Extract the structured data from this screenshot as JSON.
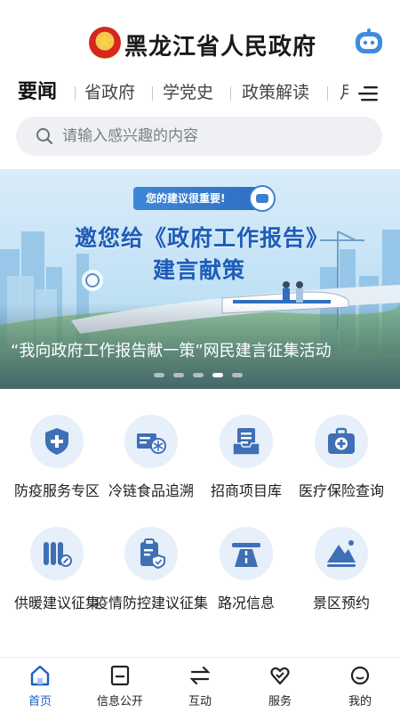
{
  "header": {
    "title": "黑龙江省人民政府",
    "emblem_icon": "national-emblem-icon",
    "assistant_icon": "robot-assistant-icon"
  },
  "nav": {
    "tabs": [
      {
        "label": "要闻",
        "active": true
      },
      {
        "label": "省政府",
        "active": false
      },
      {
        "label": "学党史",
        "active": false
      },
      {
        "label": "政策解读",
        "active": false
      },
      {
        "label": "月",
        "active": false
      }
    ],
    "menu_icon": "menu-icon"
  },
  "search": {
    "placeholder": "请输入感兴趣的内容",
    "icon": "search-icon"
  },
  "banner": {
    "badge": "您的建议很重要!",
    "headline_line1": "邀您给《政府工作报告》",
    "headline_line2": "建言献策",
    "caption": "“我向政府工作报告献一策”网民建言征集活动",
    "slide_count": 5,
    "active_slide": 4
  },
  "services": [
    {
      "label": "防疫服务专区",
      "icon": "shield-plus-icon"
    },
    {
      "label": "冷链食品追溯",
      "icon": "cold-chain-truck-icon"
    },
    {
      "label": "招商项目库",
      "icon": "project-list-icon"
    },
    {
      "label": "医疗保险查询",
      "icon": "medical-kit-icon"
    },
    {
      "label": "供暖建议征集",
      "icon": "radiator-icon"
    },
    {
      "label": "疫情防控建议征集",
      "icon": "clipboard-shield-icon"
    },
    {
      "label": "路况信息",
      "icon": "road-icon"
    },
    {
      "label": "景区预约",
      "icon": "mountain-icon"
    }
  ],
  "bottom_nav": [
    {
      "label": "首页",
      "icon": "home-icon",
      "active": true
    },
    {
      "label": "信息公开",
      "icon": "document-icon",
      "active": false
    },
    {
      "label": "互动",
      "icon": "exchange-icon",
      "active": false
    },
    {
      "label": "服务",
      "icon": "heart-check-icon",
      "active": false
    },
    {
      "label": "我的",
      "icon": "profile-face-icon",
      "active": false
    }
  ],
  "colors": {
    "accent": "#1b5fc4",
    "icon_circle": "#e6effa",
    "icon_fill": "#3f6fb5",
    "search_bg": "#eef0f3"
  }
}
